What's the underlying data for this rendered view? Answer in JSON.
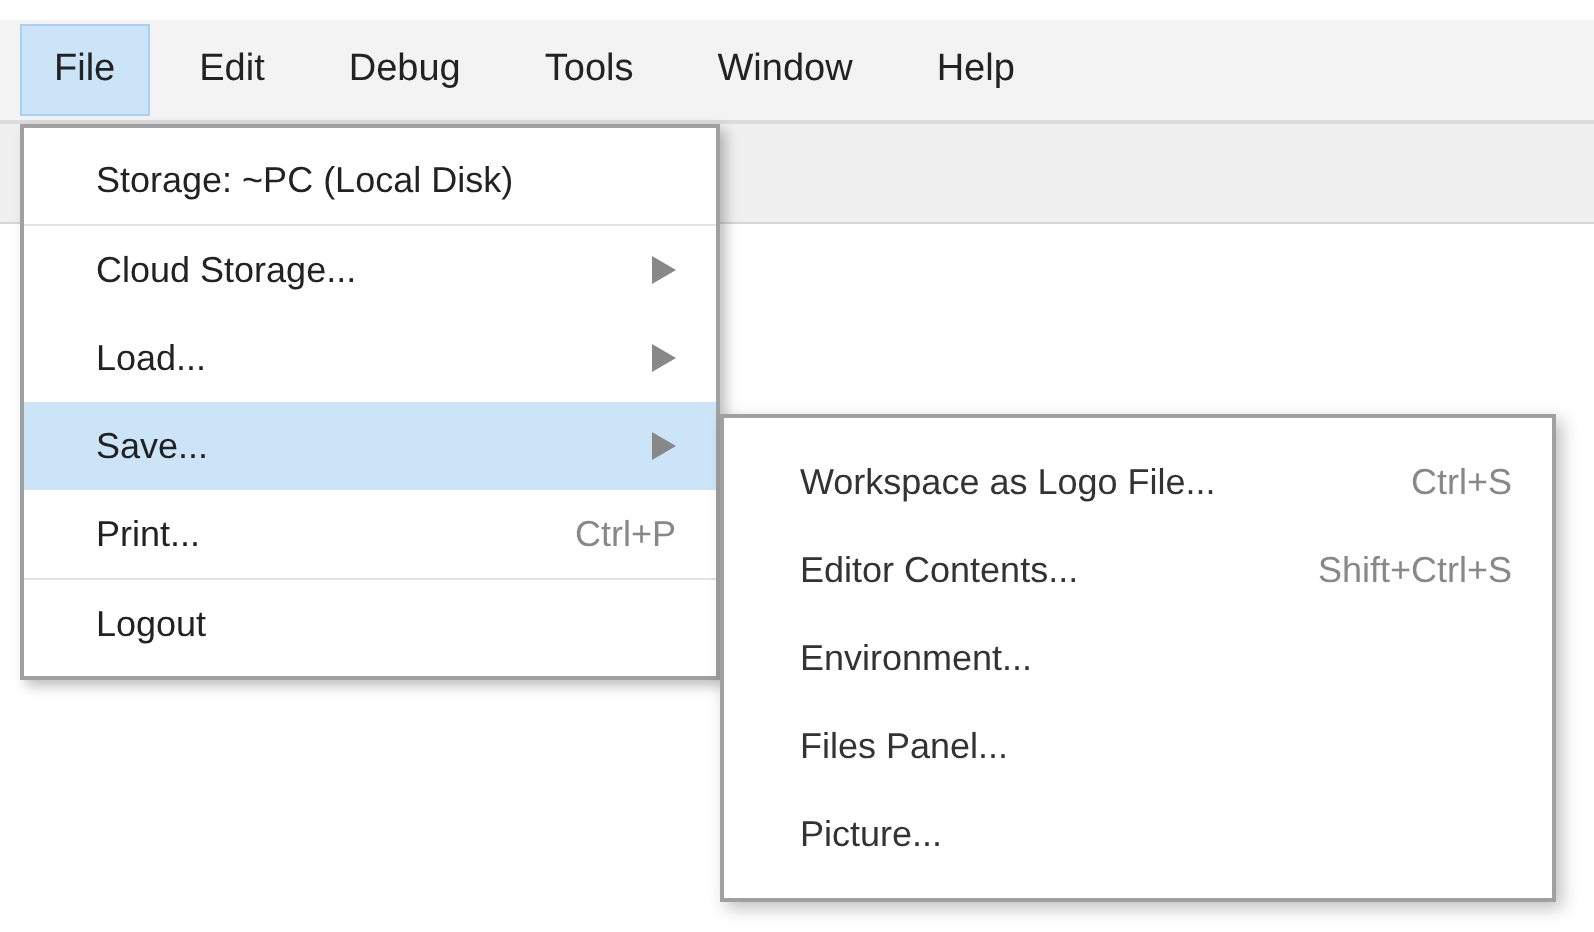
{
  "menu_bar": [
    {
      "label": "File",
      "selected": true
    },
    {
      "label": "Edit",
      "selected": false
    },
    {
      "label": "Debug",
      "selected": false
    },
    {
      "label": "Tools",
      "selected": false
    },
    {
      "label": "Window",
      "selected": false
    },
    {
      "label": "Help",
      "selected": false
    }
  ],
  "file_menu": [
    {
      "label": "Storage: ~PC (Local Disk)",
      "selected": false,
      "has_submenu": false,
      "separator_after": true
    },
    {
      "label": "Cloud Storage...",
      "selected": false,
      "has_submenu": true,
      "separator_after": false
    },
    {
      "label": "Load...",
      "selected": false,
      "has_submenu": true,
      "separator_after": false
    },
    {
      "label": "Save...",
      "selected": true,
      "has_submenu": true,
      "separator_after": false
    },
    {
      "label": "Print...",
      "shortcut": "Ctrl+P",
      "selected": false,
      "has_submenu": false,
      "separator_after": true
    },
    {
      "label": "Logout",
      "selected": false,
      "has_submenu": false,
      "separator_after": false
    }
  ],
  "save_submenu": [
    {
      "label": "Workspace as Logo File...",
      "shortcut": "Ctrl+S"
    },
    {
      "label": "Editor Contents...",
      "shortcut": "Shift+Ctrl+S"
    },
    {
      "label": "Environment..."
    },
    {
      "label": "Files Panel..."
    },
    {
      "label": "Picture..."
    }
  ]
}
